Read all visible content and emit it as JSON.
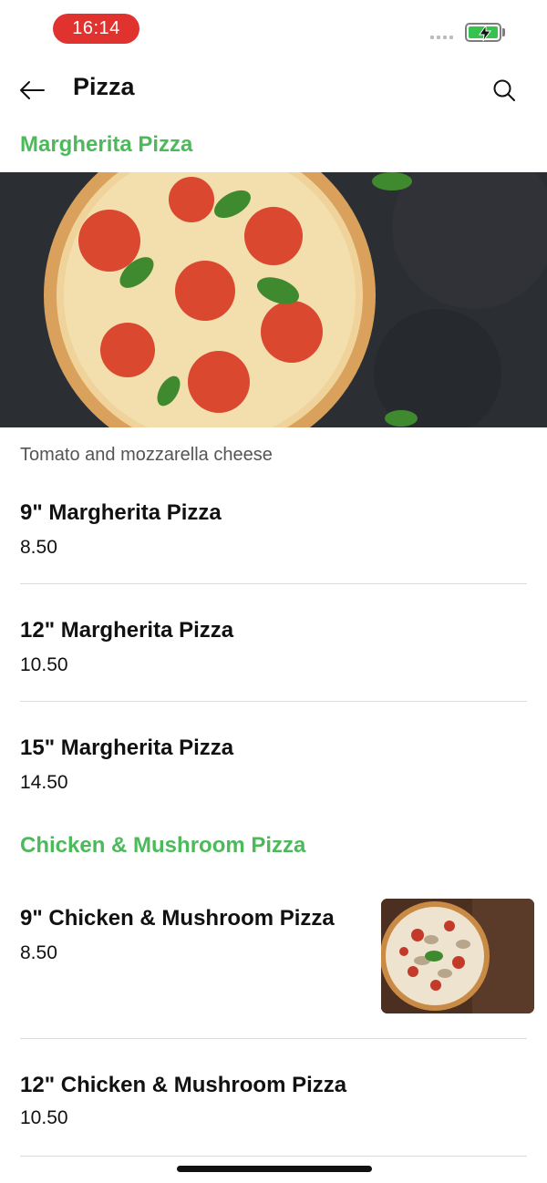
{
  "status_bar": {
    "time": "16:14"
  },
  "header": {
    "title": "Pizza",
    "back_icon": "arrow-left-icon",
    "search_icon": "search-icon"
  },
  "categories": [
    {
      "title": "Margherita Pizza",
      "description": "Tomato and mozzarella cheese",
      "items": [
        {
          "name": "9\" Margherita Pizza",
          "price": "8.50"
        },
        {
          "name": "12\" Margherita Pizza",
          "price": "10.50"
        },
        {
          "name": "15\" Margherita Pizza",
          "price": "14.50"
        }
      ]
    },
    {
      "title": "Chicken & Mushroom Pizza",
      "items": [
        {
          "name": "9\" Chicken & Mushroom Pizza",
          "price": "8.50"
        },
        {
          "name": "12\" Chicken & Mushroom Pizza",
          "price": "10.50"
        }
      ]
    }
  ],
  "colors": {
    "accent": "#4cba5a",
    "time_pill": "#e0332f",
    "battery": "#35c24e"
  }
}
